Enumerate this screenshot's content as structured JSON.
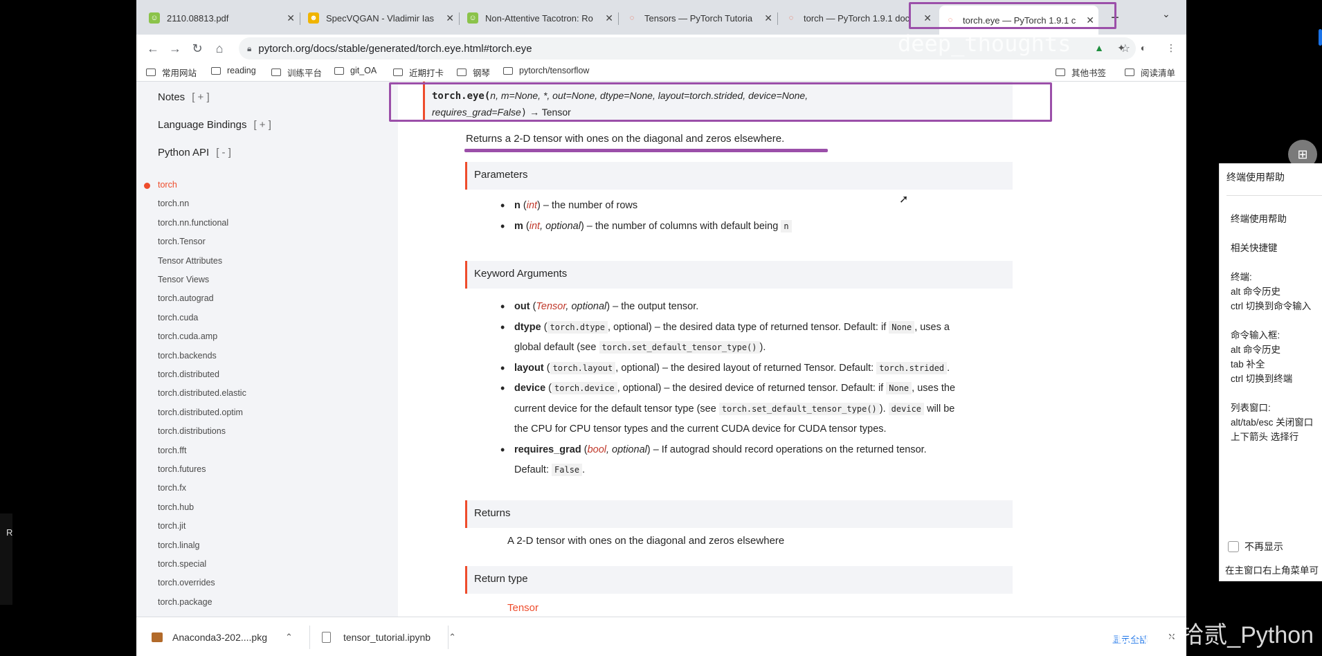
{
  "tabs": [
    {
      "title": "2110.08813.pdf",
      "favicon": "green-face"
    },
    {
      "title": "SpecVQGAN - Vladimir Ias",
      "favicon": "yellow-face"
    },
    {
      "title": "Non-Attentive Tacotron: Ro",
      "favicon": "green-face"
    },
    {
      "title": "Tensors — PyTorch Tutoria",
      "favicon": "torch"
    },
    {
      "title": "torch — PyTorch 1.9.1 doc",
      "favicon": "torch"
    },
    {
      "title": "torch.eye — PyTorch 1.9.1 c",
      "favicon": "torch",
      "active": true
    }
  ],
  "toolbar": {
    "url": "pytorch.org/docs/stable/generated/torch.eye.html#torch.eye"
  },
  "watermark_top": "deep_thoughts",
  "bookmarks": [
    "常用网站",
    "reading",
    "训练平台",
    "git_OA",
    "近期打卡",
    "钢琴",
    "pytorch/tensorflow",
    "其他书签",
    "阅读清单"
  ],
  "sidebar": {
    "notes": "Notes",
    "notes_toggle": "[ + ]",
    "bindings": "Language Bindings",
    "bindings_toggle": "[ + ]",
    "python_api": "Python API",
    "python_api_toggle": "[ - ]",
    "items": [
      "torch",
      "torch.nn",
      "torch.nn.functional",
      "torch.Tensor",
      "Tensor Attributes",
      "Tensor Views",
      "torch.autograd",
      "torch.cuda",
      "torch.cuda.amp",
      "torch.backends",
      "torch.distributed",
      "torch.distributed.elastic",
      "torch.distributed.optim",
      "torch.distributions",
      "torch.fft",
      "torch.futures",
      "torch.fx",
      "torch.hub",
      "torch.jit",
      "torch.linalg",
      "torch.special",
      "torch.overrides",
      "torch.package"
    ]
  },
  "doc": {
    "sig_fn": "torch.eye(",
    "sig_params_1": "n, m=None, *, out=None, dtype=None, layout=torch.strided, device=None,",
    "sig_params_2": "requires_grad=False",
    "sig_close": ")",
    "sig_ret": " → Tensor",
    "description": "Returns a 2-D tensor with ones on the diagonal and zeros elsewhere.",
    "parameters_heading": "Parameters",
    "p_n_name": "n",
    "p_n_type": "int",
    "p_n_desc": ") – the number of rows",
    "p_m_name": "m",
    "p_m_type": "int",
    "p_m_opt": ", optional",
    "p_m_desc": ") – the number of columns with default being",
    "p_m_code": "n",
    "kwargs_heading": "Keyword Arguments",
    "k_out_name": "out",
    "k_out_type": "Tensor",
    "k_out_opt": ", optional",
    "k_out_desc": ") – the output tensor.",
    "k_dtype_name": "dtype",
    "k_dtype_code": "torch.dtype",
    "k_dtype_desc1": ", optional) – the desired data type of returned tensor. Default: if",
    "k_dtype_none": "None",
    "k_dtype_desc2": ", uses a",
    "k_dtype_desc3": "global default (see",
    "k_dtype_code2": "torch.set_default_tensor_type()",
    "k_dtype_desc4": ").",
    "k_layout_name": "layout",
    "k_layout_code": "torch.layout",
    "k_layout_desc": ", optional) – the desired layout of returned Tensor. Default:",
    "k_layout_default": "torch.strided",
    "k_device_name": "device",
    "k_device_code": "torch.device",
    "k_device_desc1": ", optional) – the desired device of returned tensor. Default: if",
    "k_device_none": "None",
    "k_device_desc2": ", uses the",
    "k_device_desc3": "current device for the default tensor type (see",
    "k_device_code2": "torch.set_default_tensor_type()",
    "k_device_desc4": ").",
    "k_device_code3": "device",
    "k_device_desc5": "will be",
    "k_device_desc6": "the CPU for CPU tensor types and the current CUDA device for CUDA tensor types.",
    "k_rg_name": "requires_grad",
    "k_rg_type": "bool",
    "k_rg_opt": ", optional",
    "k_rg_desc": ") – If autograd should record operations on the returned tensor.",
    "k_rg_default_label": "Default:",
    "k_rg_default": "False",
    "returns_heading": "Returns",
    "returns_text": "A 2-D tensor with ones on the diagonal and zeros elsewhere",
    "rettype_heading": "Return type",
    "rettype_text": "Tensor"
  },
  "downloads": [
    {
      "name": "Anaconda3-202....pkg"
    },
    {
      "name": "tensor_tutorial.ipynb"
    }
  ],
  "downloads_show_all": "显示全部",
  "watermark_bottom": "CSDN @拾贰_Python",
  "help_panel": {
    "header": "终端使用帮助",
    "body": "终端使用帮助\n\n相关快捷键\n\n终端:\nalt 命令历史\nctrl 切换到命令输入\n\n命令输入框:\nalt 命令历史\ntab 补全\nctrl 切换到终端\n\n列表窗口:\nalt/tab/esc 关闭窗口\n上下箭头 选择行",
    "no_show": "不再显示",
    "footer": "在主窗口右上角菜单可"
  },
  "left_stub": "R",
  "colors": {
    "accent": "#ee4c2c",
    "annotation": "#9b4fa9",
    "sidebar_bg": "#f3f4f7"
  }
}
